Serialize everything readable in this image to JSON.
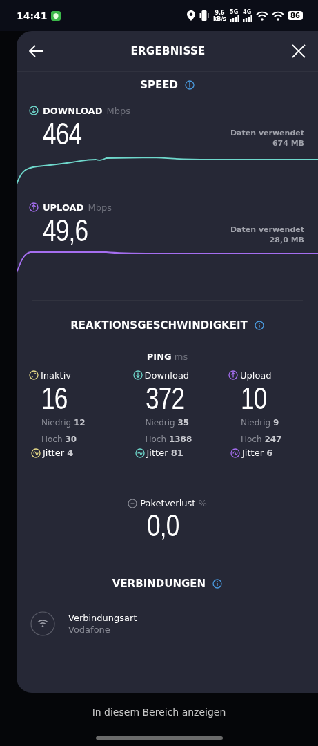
{
  "status_bar": {
    "time": "14:41",
    "net_speed": [
      "9.6",
      "kB/s"
    ],
    "networks": [
      "5G",
      "4G"
    ],
    "battery": "86"
  },
  "header": {
    "title": "ERGEBNISSE"
  },
  "speed": {
    "title": "SPEED",
    "tests": [
      {
        "kind": "download",
        "label": "DOWNLOAD",
        "unit": "Mbps",
        "value": "464",
        "data_label": "Daten verwendet",
        "data_amount": "674 MB"
      },
      {
        "kind": "upload",
        "label": "UPLOAD",
        "unit": "Mbps",
        "value": "49,6",
        "data_label": "Daten verwendet",
        "data_amount": "28,0 MB"
      }
    ]
  },
  "latency": {
    "title": "REAKTIONSGESCHWINDIGKEIT",
    "ping_label": "PING",
    "unit": "ms",
    "columns": [
      {
        "kind": "idle",
        "label": "Inaktiv",
        "value": "16",
        "low_label": "Niedrig",
        "low": "12",
        "high_label": "Hoch",
        "high": "30",
        "jitter_label": "Jitter",
        "jitter": "4"
      },
      {
        "kind": "download",
        "label": "Download",
        "value": "372",
        "low_label": "Niedrig",
        "low": "35",
        "high_label": "Hoch",
        "high": "1388",
        "jitter_label": "Jitter",
        "jitter": "81"
      },
      {
        "kind": "upload",
        "label": "Upload",
        "value": "10",
        "low_label": "Niedrig",
        "low": "9",
        "high_label": "Hoch",
        "high": "247",
        "jitter_label": "Jitter",
        "jitter": "6"
      }
    ]
  },
  "packet_loss": {
    "label": "Paketverlust",
    "unit": "%",
    "value": "0,0"
  },
  "connections": {
    "title": "VERBINDUNGEN",
    "items": [
      {
        "label": "Verbindungsart",
        "value": "Vodafone"
      }
    ]
  },
  "footer": {
    "text": "In diesem Bereich anzeigen"
  }
}
